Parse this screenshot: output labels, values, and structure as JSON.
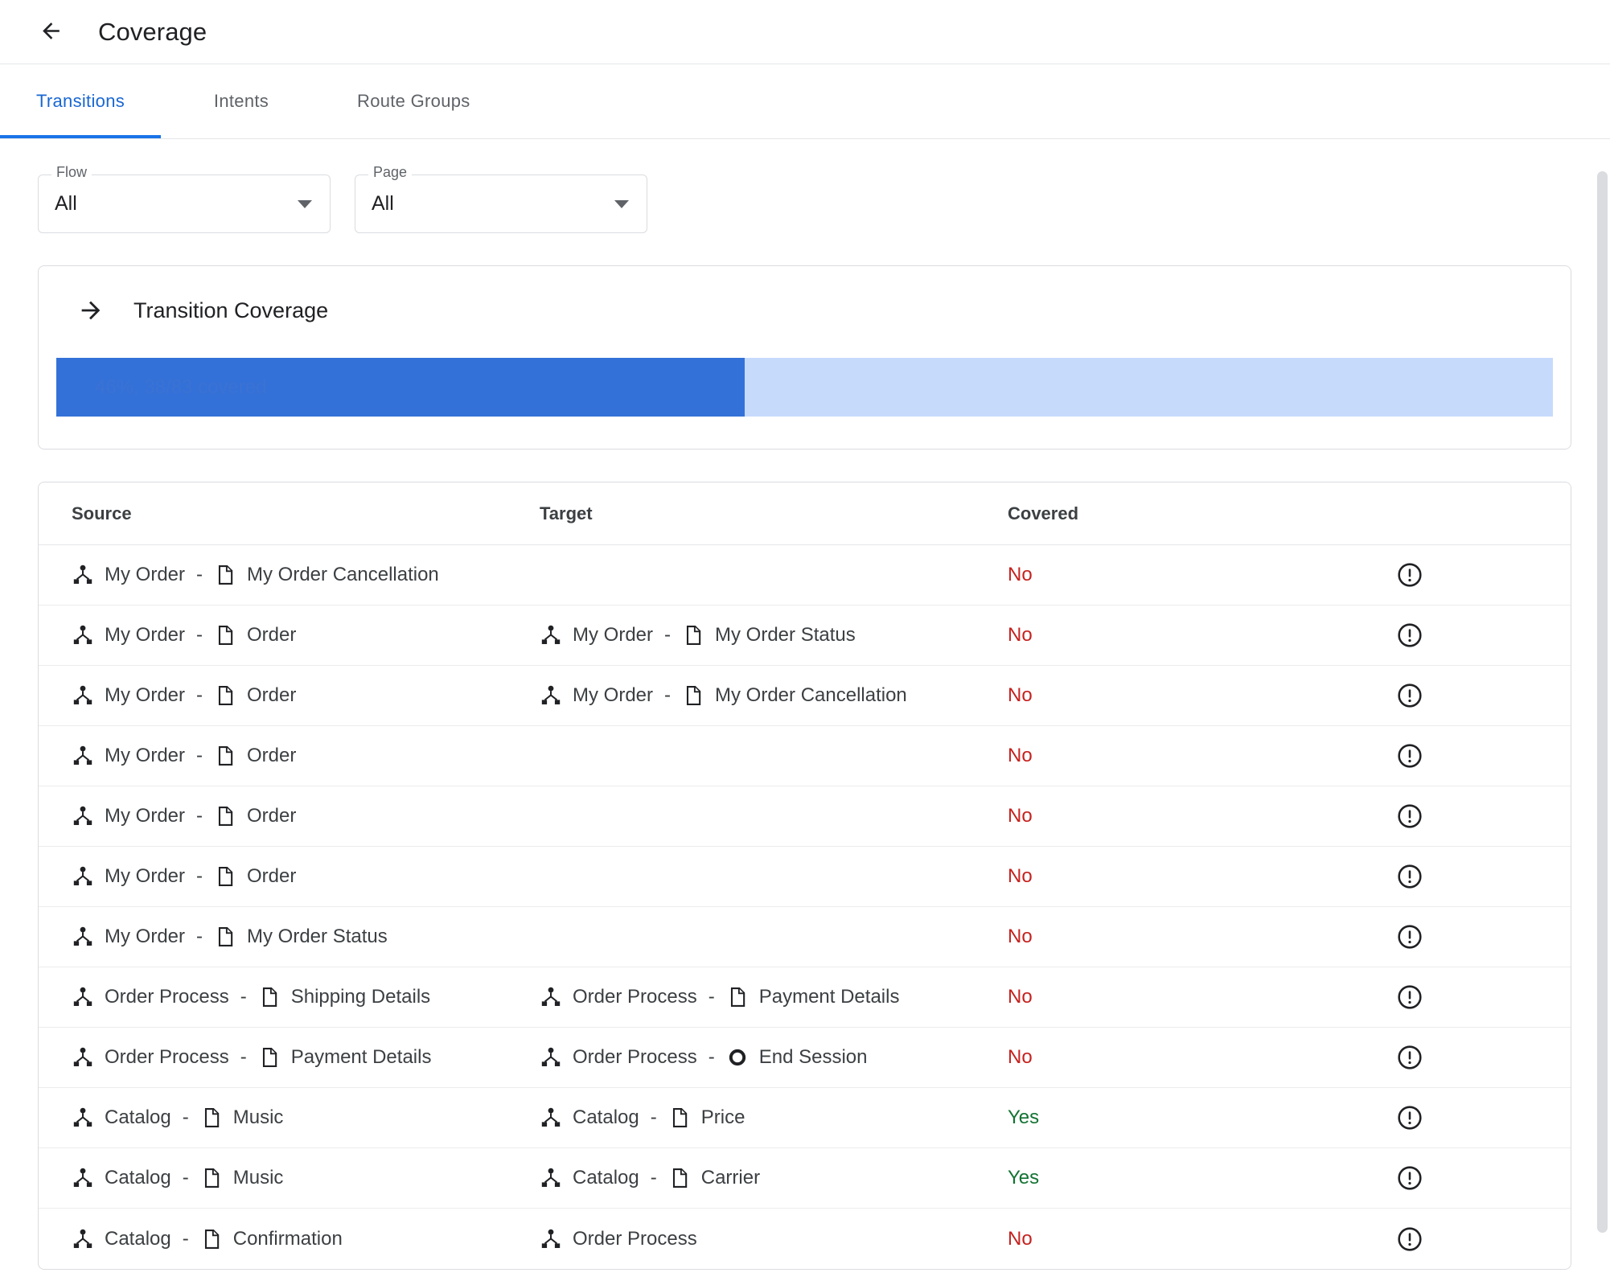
{
  "header": {
    "back_icon": "arrow-back-icon",
    "title": "Coverage"
  },
  "tabs": [
    {
      "label": "Transitions",
      "active": true
    },
    {
      "label": "Intents",
      "active": false
    },
    {
      "label": "Route Groups",
      "active": false
    }
  ],
  "filters": {
    "flow": {
      "label": "Flow",
      "value": "All",
      "arrow_icon": "chevron-down-icon"
    },
    "page": {
      "label": "Page",
      "value": "All",
      "arrow_icon": "chevron-down-icon"
    }
  },
  "coverage_card": {
    "icon": "arrow-right-icon",
    "title": "Transition Coverage",
    "percent": 46,
    "covered_count": 38,
    "total_count": 83,
    "progress_text": "46%, 38/83 covered",
    "fill_color": "#3371d8",
    "track_color": "#c6dafc",
    "text_color": "#3b72d4"
  },
  "table": {
    "columns": [
      "Source",
      "Target",
      "Covered"
    ],
    "row_icon": "error-outline-icon",
    "rows": [
      {
        "source": [
          {
            "icon": "flow-icon",
            "label": "My Order"
          },
          {
            "icon": "page-icon",
            "label": "My Order Cancellation"
          }
        ],
        "target": [],
        "covered": "No",
        "covered_state": "no"
      },
      {
        "source": [
          {
            "icon": "flow-icon",
            "label": "My Order"
          },
          {
            "icon": "page-icon",
            "label": "Order"
          }
        ],
        "target": [
          {
            "icon": "flow-icon",
            "label": "My Order"
          },
          {
            "icon": "page-icon",
            "label": "My Order Status"
          }
        ],
        "covered": "No",
        "covered_state": "no"
      },
      {
        "source": [
          {
            "icon": "flow-icon",
            "label": "My Order"
          },
          {
            "icon": "page-icon",
            "label": "Order"
          }
        ],
        "target": [
          {
            "icon": "flow-icon",
            "label": "My Order"
          },
          {
            "icon": "page-icon",
            "label": "My Order Cancellation"
          }
        ],
        "covered": "No",
        "covered_state": "no"
      },
      {
        "source": [
          {
            "icon": "flow-icon",
            "label": "My Order"
          },
          {
            "icon": "page-icon",
            "label": "Order"
          }
        ],
        "target": [],
        "covered": "No",
        "covered_state": "no"
      },
      {
        "source": [
          {
            "icon": "flow-icon",
            "label": "My Order"
          },
          {
            "icon": "page-icon",
            "label": "Order"
          }
        ],
        "target": [],
        "covered": "No",
        "covered_state": "no"
      },
      {
        "source": [
          {
            "icon": "flow-icon",
            "label": "My Order"
          },
          {
            "icon": "page-icon",
            "label": "Order"
          }
        ],
        "target": [],
        "covered": "No",
        "covered_state": "no"
      },
      {
        "source": [
          {
            "icon": "flow-icon",
            "label": "My Order"
          },
          {
            "icon": "page-icon",
            "label": "My Order Status"
          }
        ],
        "target": [],
        "covered": "No",
        "covered_state": "no"
      },
      {
        "source": [
          {
            "icon": "flow-icon",
            "label": "Order Process"
          },
          {
            "icon": "page-icon",
            "label": "Shipping Details"
          }
        ],
        "target": [
          {
            "icon": "flow-icon",
            "label": "Order Process"
          },
          {
            "icon": "page-icon",
            "label": "Payment Details"
          }
        ],
        "covered": "No",
        "covered_state": "no"
      },
      {
        "source": [
          {
            "icon": "flow-icon",
            "label": "Order Process"
          },
          {
            "icon": "page-icon",
            "label": "Payment Details"
          }
        ],
        "target": [
          {
            "icon": "flow-icon",
            "label": "Order Process"
          },
          {
            "icon": "end-session-icon",
            "label": "End Session"
          }
        ],
        "covered": "No",
        "covered_state": "no"
      },
      {
        "source": [
          {
            "icon": "flow-icon",
            "label": "Catalog"
          },
          {
            "icon": "page-icon",
            "label": "Music"
          }
        ],
        "target": [
          {
            "icon": "flow-icon",
            "label": "Catalog"
          },
          {
            "icon": "page-icon",
            "label": "Price"
          }
        ],
        "covered": "Yes",
        "covered_state": "yes"
      },
      {
        "source": [
          {
            "icon": "flow-icon",
            "label": "Catalog"
          },
          {
            "icon": "page-icon",
            "label": "Music"
          }
        ],
        "target": [
          {
            "icon": "flow-icon",
            "label": "Catalog"
          },
          {
            "icon": "page-icon",
            "label": "Carrier"
          }
        ],
        "covered": "Yes",
        "covered_state": "yes"
      },
      {
        "source": [
          {
            "icon": "flow-icon",
            "label": "Catalog"
          },
          {
            "icon": "page-icon",
            "label": "Confirmation"
          }
        ],
        "target": [
          {
            "icon": "flow-icon",
            "label": "Order Process"
          }
        ],
        "covered": "No",
        "covered_state": "no"
      }
    ]
  },
  "scrollbar": {
    "name": "vertical-scrollbar"
  },
  "colors": {
    "accent": "#1a73e8",
    "tab_active": "#1967d2",
    "no": "#c5221f",
    "yes": "#137333",
    "text": "#3c4043",
    "border": "#dadce0"
  }
}
